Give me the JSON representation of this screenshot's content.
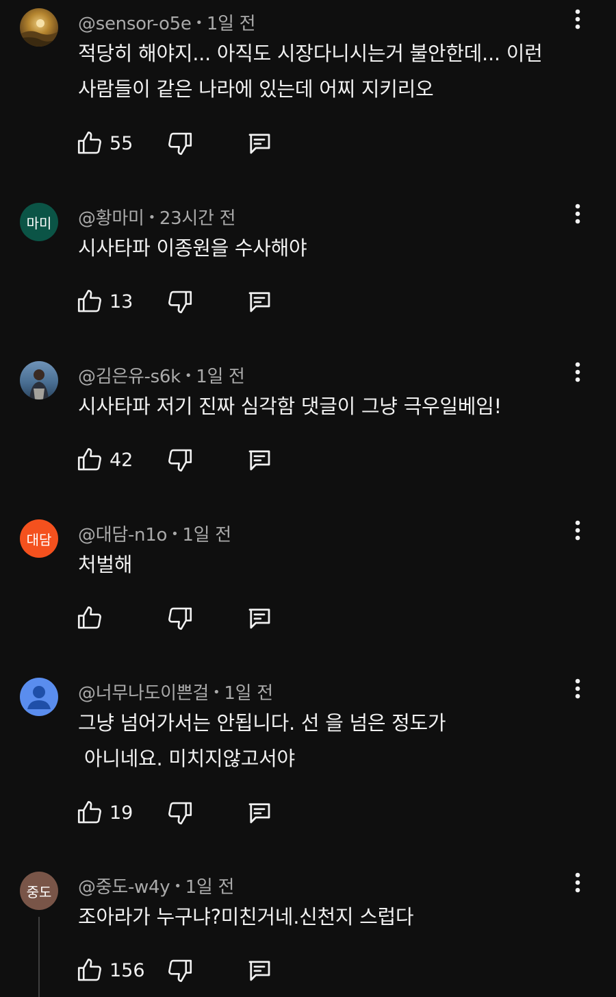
{
  "comments": [
    {
      "author": "@sensor-o5e",
      "time": "1일 전",
      "text": "적당히 해야지... 아직도 시장다니시는거 불안한데... 이런\n사람들이 같은 나라에 있는데 어찌 지키리오",
      "likes": "55",
      "avatar_text": "",
      "avatar_color": "#8a6a2e"
    },
    {
      "author": "@황마미",
      "time": "23시간 전",
      "text": "시사타파 이종원을 수사해야",
      "likes": "13",
      "avatar_text": "마미",
      "avatar_color": "#0b5446"
    },
    {
      "author": "@김은유-s6k",
      "time": "1일 전",
      "text": "시사타파 저기 진짜 심각함 댓글이 그냥 극우일베임!",
      "likes": "42",
      "avatar_text": "",
      "avatar_color": "#4c6f8f"
    },
    {
      "author": "@대담-n1o",
      "time": "1일 전",
      "text": "처벌해",
      "likes": "",
      "avatar_text": "대담",
      "avatar_color": "#f4511e"
    },
    {
      "author": "@너무나도이쁜걸",
      "time": "1일 전",
      "text": "그냥 넘어가서는 안됩니다. 선 을 넘은 정도가\n 아니네요. 미치지않고서야",
      "likes": "19",
      "avatar_text": "",
      "avatar_color": "#5a8dee"
    },
    {
      "author": "@중도-w4y",
      "time": "1일 전",
      "text": "조아라가 누구냐?미친거네.신천지 스럽다",
      "likes": "156",
      "avatar_text": "중도",
      "avatar_color": "#795548"
    }
  ]
}
